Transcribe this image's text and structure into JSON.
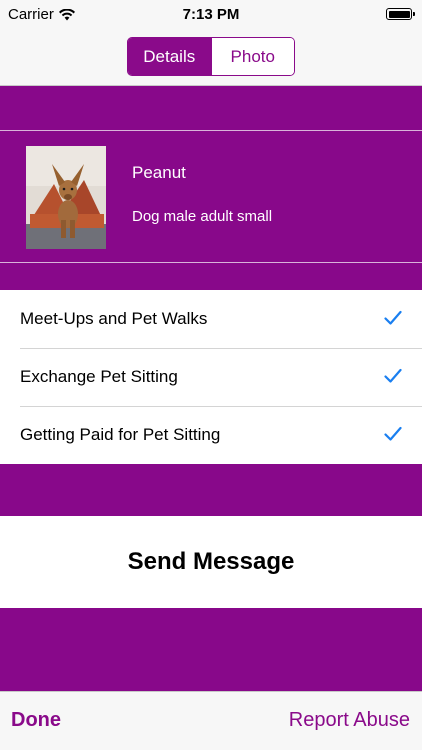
{
  "status_bar": {
    "carrier": "Carrier",
    "time": "7:13 PM",
    "wifi_icon": "wifi-icon",
    "battery_icon": "battery-icon"
  },
  "segmented_control": {
    "selected": "Details",
    "segments": [
      "Details",
      "Photo"
    ]
  },
  "pet": {
    "name": "Peanut",
    "description": "Dog male adult small",
    "photo_icon": "dog-photo"
  },
  "services": [
    {
      "label": "Meet-Ups and Pet Walks",
      "checked": true
    },
    {
      "label": "Exchange Pet Sitting",
      "checked": true
    },
    {
      "label": "Getting Paid for Pet Sitting",
      "checked": true
    }
  ],
  "send_message_label": "Send Message",
  "toolbar": {
    "done_label": "Done",
    "report_label": "Report Abuse"
  },
  "colors": {
    "accent": "#8a0a8a",
    "background_purple": "#88088a",
    "check_blue": "#1a7ff0"
  }
}
